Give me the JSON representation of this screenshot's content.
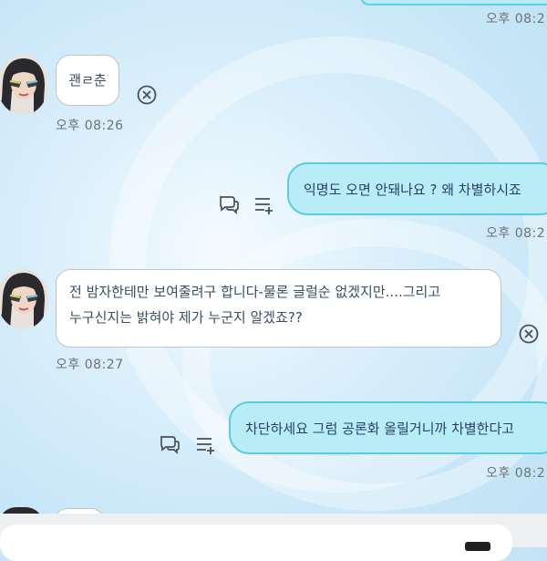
{
  "messages": [
    {
      "id": "top-out",
      "time": "오후 08:2"
    },
    {
      "id": "in1",
      "text": "괜ㄹ춘",
      "time": "오후 08:26"
    },
    {
      "id": "out1",
      "text": "익명도 오면 안돼나요 ? 왜 차별하시죠",
      "time": "오후 08:2"
    },
    {
      "id": "in2",
      "lines": [
        "전 밤자한테만 보여줄려구 합니다-물론 글럴순 없겠지만....그리고",
        "누구신지는 밝혀야 제가 누군지 알겠죠??"
      ],
      "time": "오후 08:27"
    },
    {
      "id": "out2",
      "text": "차단하세요 그럼 공론화 올릴거니까 차별한다고",
      "time": "오후 08:2"
    }
  ],
  "icons": {
    "delete": "close-circle-icon",
    "comment": "chat-bubbles-icon",
    "reply": "list-add-icon",
    "send": "send-icon"
  },
  "colors": {
    "outgoing_bubble": "#b8edf8",
    "outgoing_border": "#57cce3",
    "incoming_bubble": "#ffffff",
    "text": "#3b4f66"
  }
}
